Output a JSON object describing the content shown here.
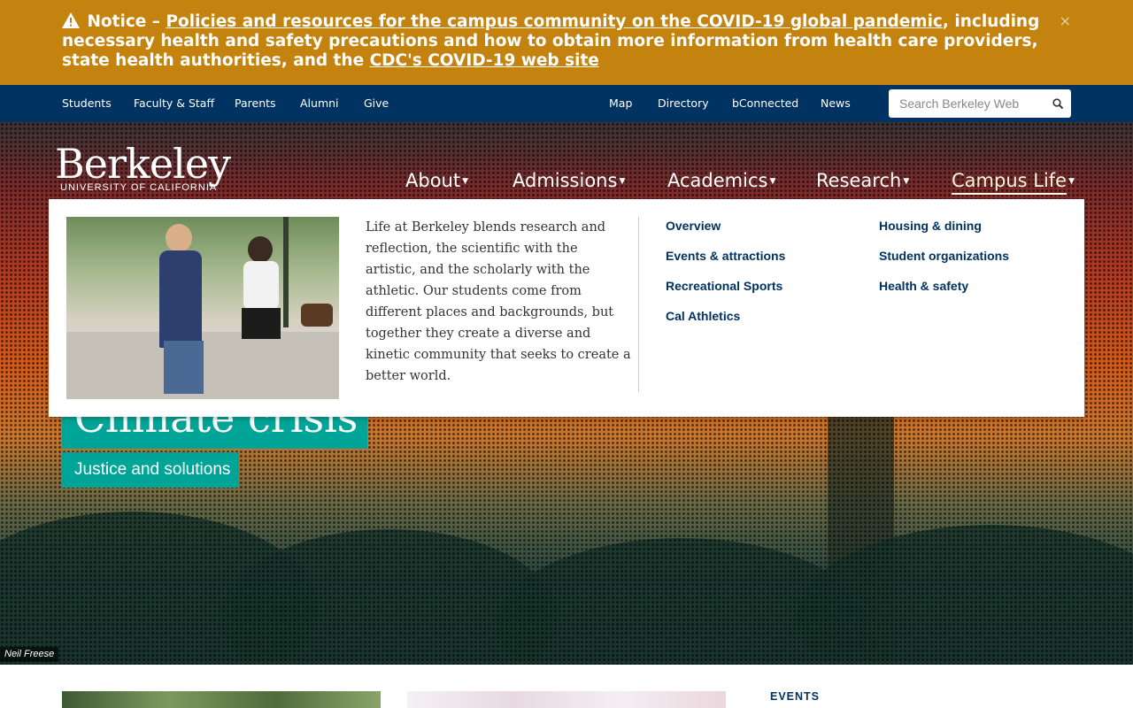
{
  "notice": {
    "label": "Notice –",
    "link_text": "Policies and resources for the campus community on the COVID-19 global pandemic",
    "middle_text": ", including necessary health and safety precautions and how to obtain more information from health care providers, state health authorities, and the",
    "cdc_link": "CDC's COVID-19 web site",
    "close": "×",
    "color": "#c4820e"
  },
  "utility_nav": {
    "left": [
      "Students",
      "Faculty & Staff",
      "Parents",
      "Alumni",
      "Give"
    ],
    "right": [
      "Map",
      "Directory",
      "bConnected",
      "News"
    ],
    "search_placeholder": "Search Berkeley Web",
    "color": "#003262"
  },
  "logo": {
    "wordmark": "Berkeley",
    "subtitle": "UNIVERSITY OF CALIFORNIA"
  },
  "main_nav": {
    "items": [
      "About",
      "Admissions",
      "Academics",
      "Research",
      "Campus Life"
    ],
    "active": "Campus Life"
  },
  "hero": {
    "title": "Climate crisis",
    "subtitle": "Justice and solutions",
    "photo_credit": "Neil Freese",
    "accent": "#00a598"
  },
  "dropdown": {
    "blurb": "Life at Berkeley blends research and reflection, the scientific with the artistic, and the scholarly with the athletic. Our students come from different places and backgrounds, but together they create a diverse and kinetic community that seeks to create a better world.",
    "col1": [
      "Overview",
      "Events & attractions",
      "Recreational Sports",
      "Cal Athletics"
    ],
    "col2": [
      "Housing & dining",
      "Student organizations",
      "Health & safety"
    ]
  },
  "events_heading": "EVENTS"
}
